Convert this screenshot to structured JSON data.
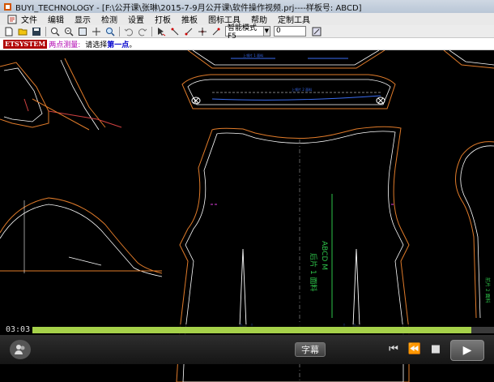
{
  "window": {
    "title": "BUYI_TECHNOLOGY - [F:\\公开课\\张琳\\2015-7-9月公开课\\软件操作视频.prj----样板号: ABCD]"
  },
  "menu": {
    "items": [
      "文件",
      "编辑",
      "显示",
      "检测",
      "设置",
      "打板",
      "推板",
      "图标工具",
      "帮助",
      "定制工具"
    ]
  },
  "toolbar": {
    "mode_select": "智能模式F5",
    "number_value": "0"
  },
  "status": {
    "logo": "ETSYSTEM",
    "prompt_label": "两点测量:",
    "prompt_text": "请选择",
    "prompt_emph": "第一点",
    "prompt_end": "。"
  },
  "canvas": {
    "piece_label_1": "ABCD M",
    "piece_label_2": "后片 1  面料",
    "piece_label_right": "前片 2  面料",
    "top_label_1": "上领片 1 面料",
    "top_label_2": "上领片 2 面料"
  },
  "player": {
    "time": "03:03",
    "progress": 0.95,
    "subtitle_label": "字幕",
    "accent_color": "#a6d14a"
  }
}
